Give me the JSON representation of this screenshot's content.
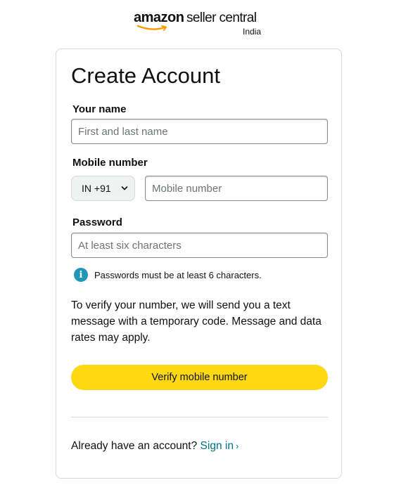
{
  "logo": {
    "brand": "amazon",
    "product": "seller central",
    "region": "India",
    "smile_color": "#ff9900"
  },
  "form": {
    "title": "Create Account",
    "name": {
      "label": "Your name",
      "placeholder": "First and last name",
      "value": ""
    },
    "mobile": {
      "label": "Mobile number",
      "country_code": "IN +91",
      "placeholder": "Mobile number",
      "value": ""
    },
    "password": {
      "label": "Password",
      "placeholder": "At least six characters",
      "value": ""
    },
    "password_hint": "Passwords must be at least 6 characters.",
    "verify_note": "To verify your number, we will send you a text message with a temporary code. Message and data rates may apply.",
    "submit_label": "Verify mobile number"
  },
  "footer": {
    "prompt": "Already have an account?",
    "signin_label": "Sign in",
    "signin_chevron": "›"
  },
  "colors": {
    "primary_button": "#ffd814",
    "link": "#007185",
    "info_icon": "#2197b7",
    "card_border": "#d5d9d9"
  },
  "icons": {
    "info": "info-circle-icon",
    "chevron": "chevron-down-icon"
  }
}
